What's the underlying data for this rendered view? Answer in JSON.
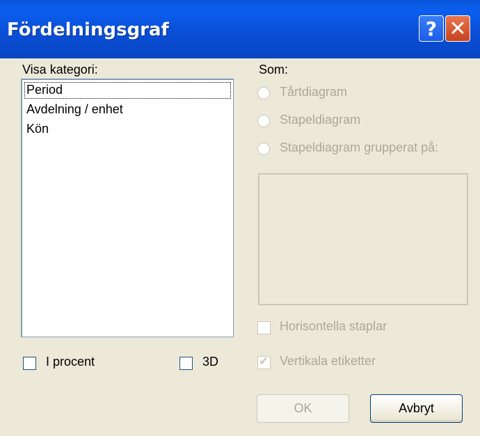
{
  "window": {
    "title": "Fördelningsgraf",
    "help_label": "?",
    "close_label": "✕"
  },
  "category": {
    "label": "Visa kategori:",
    "items": [
      "Period",
      "Avdelning / enhet",
      "Kön"
    ],
    "selected": "Period"
  },
  "options": {
    "percent_label": "I procent",
    "percent_checked": false,
    "three_d_label": "3D",
    "three_d_checked": false
  },
  "chart_type": {
    "label": "Som:",
    "pie_label": "Tårtdiagram",
    "bar_label": "Stapeldiagram",
    "grouped_bar_label": "Stapeldiagram grupperat på:",
    "horizontal_bars_label": "Horisontella staplar",
    "horizontal_bars_checked": false,
    "vertical_labels_label": "Vertikala etiketter",
    "vertical_labels_checked": true
  },
  "buttons": {
    "ok_label": "OK",
    "cancel_label": "Avbryt"
  },
  "colors": {
    "titlebar": "#0a4fd6",
    "dialog_bg": "#ece9d8",
    "disabled_text": "#aca899"
  }
}
